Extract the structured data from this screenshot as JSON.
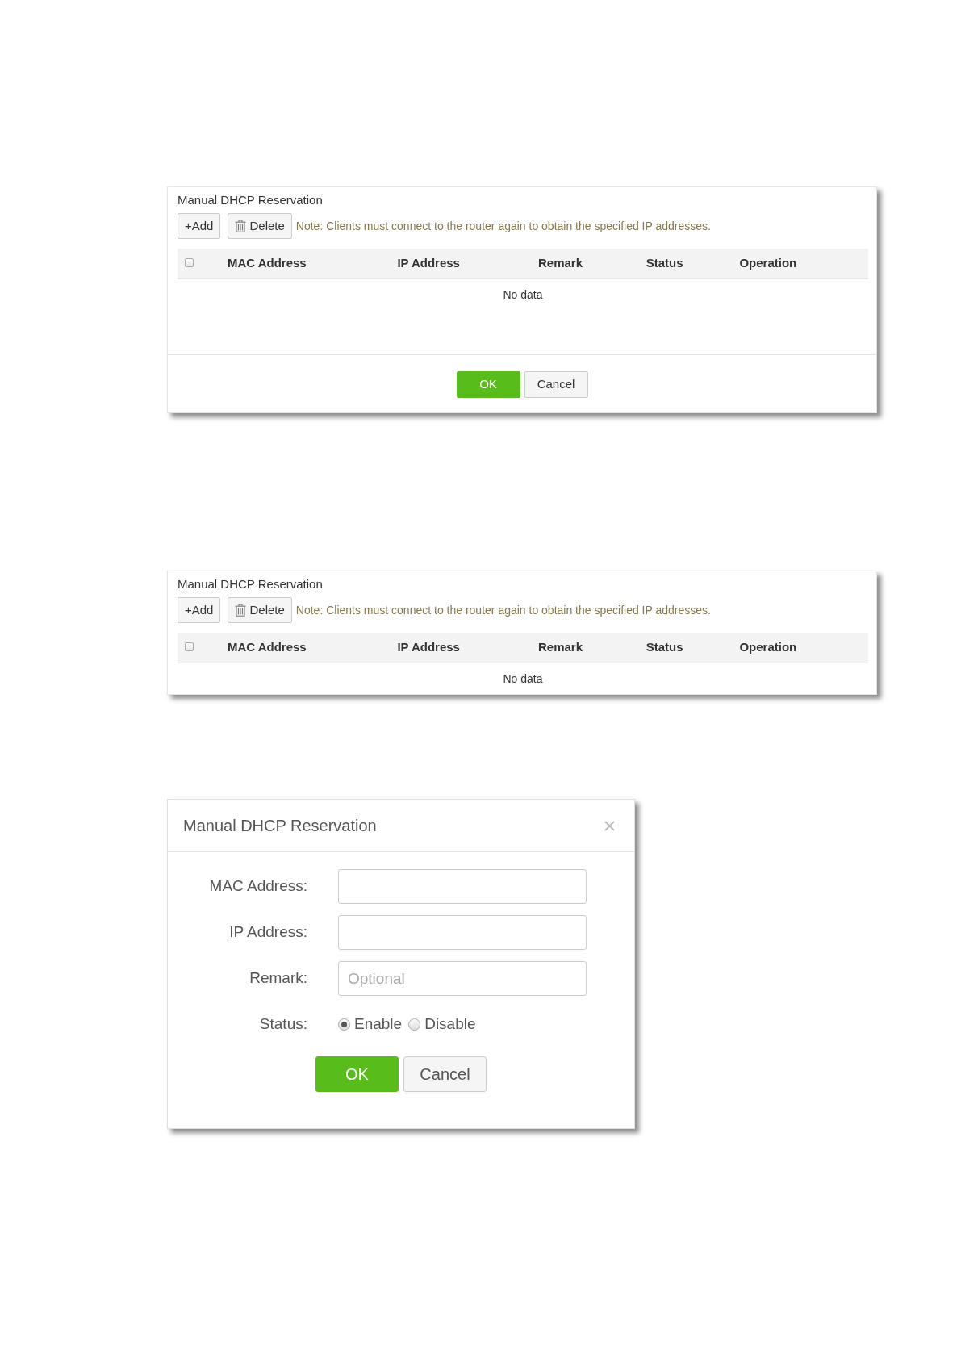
{
  "panels": [
    {
      "kind": "table_panel",
      "title": "Manual DHCP Reservation",
      "toolbar": [
        {
          "kind": "add",
          "label": "+Add"
        },
        {
          "kind": "delete",
          "label": "Delete"
        }
      ],
      "note": "Note: Clients must connect to the router again to obtain the specified IP addresses.",
      "table": {
        "header_checkbox": {
          "checked": false
        },
        "columns": [
          "MAC Address",
          "IP Address",
          "Remark",
          "Status",
          "Operation"
        ],
        "empty_text": "No data"
      },
      "footer_buttons": [
        {
          "kind": "primary",
          "label": "OK"
        },
        {
          "kind": "default",
          "label": "Cancel"
        }
      ]
    },
    {
      "kind": "table_panel",
      "title": "Manual DHCP Reservation",
      "toolbar": [
        {
          "kind": "add",
          "label": "+Add"
        },
        {
          "kind": "delete",
          "label": "Delete"
        }
      ],
      "note": "Note: Clients must connect to the router again to obtain the specified IP addresses.",
      "table": {
        "header_checkbox": {
          "checked": false
        },
        "columns": [
          "MAC Address",
          "IP Address",
          "Remark",
          "Status",
          "Operation"
        ],
        "empty_text": "No data"
      }
    }
  ],
  "dialog": {
    "title": "Manual DHCP Reservation",
    "fields": [
      {
        "label": "MAC Address:"
      },
      {
        "label": "IP Address:"
      },
      {
        "label": "Remark:",
        "placeholder": "Optional"
      }
    ],
    "status": {
      "label": "Status:",
      "options": [
        {
          "label": "Enable",
          "selected": true
        },
        {
          "label": "Disable",
          "selected": false
        }
      ]
    },
    "buttons": [
      {
        "kind": "primary",
        "label": "OK"
      },
      {
        "kind": "default",
        "label": "Cancel"
      }
    ]
  }
}
